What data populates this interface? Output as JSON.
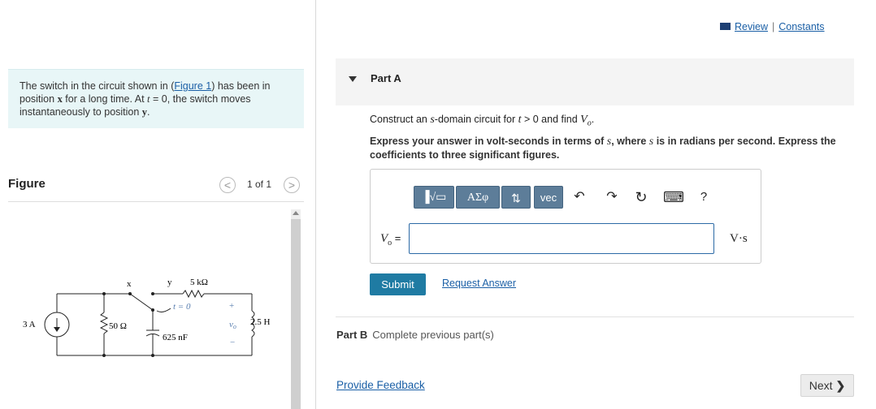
{
  "problem": {
    "text_before_link": "The switch in the circuit shown in (",
    "link": "Figure 1",
    "text_after_link": ") has been in position ",
    "pos_x": "x",
    "text_mid": " for a long time. At ",
    "t_var": "t",
    "text_eq": " = 0, the switch moves instantaneously to position ",
    "pos_y": "y",
    "text_end": "."
  },
  "figure": {
    "title": "Figure",
    "counter": "1 of 1",
    "prev_glyph": "<",
    "next_glyph": ">",
    "circuit": {
      "source": "3 A",
      "r1": "50 Ω",
      "switch_x": "x",
      "switch_y": "y",
      "switch_time": "t = 0",
      "r2": "5 kΩ",
      "cap": "625 nF",
      "vo": "v",
      "vo_sub": "o",
      "plus": "+",
      "minus": "−",
      "inductor": "2.5 H"
    }
  },
  "header": {
    "review": "Review",
    "separator": "|",
    "constants": "Constants"
  },
  "partA": {
    "title": "Part A",
    "q1_pre": "Construct an ",
    "q1_s": "s",
    "q1_mid": "-domain circuit for ",
    "q1_t": "t",
    "q1_cond": " > 0 and find ",
    "q1_v": "V",
    "q1_vsub": "o",
    "q1_end": ".",
    "q2_pre": "Express your answer in volt-seconds in terms of ",
    "q2_s1": "s",
    "q2_mid": ", where ",
    "q2_s2": "s",
    "q2_end": " is in radians per second. Express the coefficients to three significant figures.",
    "toolbar": {
      "templates": "▐√▭",
      "greek": "ΑΣφ",
      "arrows": "⇅",
      "vec": "vec",
      "undo": "↶",
      "redo": "↷",
      "reset": "↻",
      "keyboard": "⌨",
      "help": "?"
    },
    "answer_label_v": "V",
    "answer_label_sub": "o",
    "answer_label_eq": " =",
    "answer_value": "",
    "units": "V·s",
    "submit": "Submit",
    "request_answer": "Request Answer"
  },
  "partB": {
    "label": "Part B",
    "status": "Complete previous part(s)"
  },
  "footer": {
    "feedback": "Provide Feedback",
    "next": "Next"
  }
}
